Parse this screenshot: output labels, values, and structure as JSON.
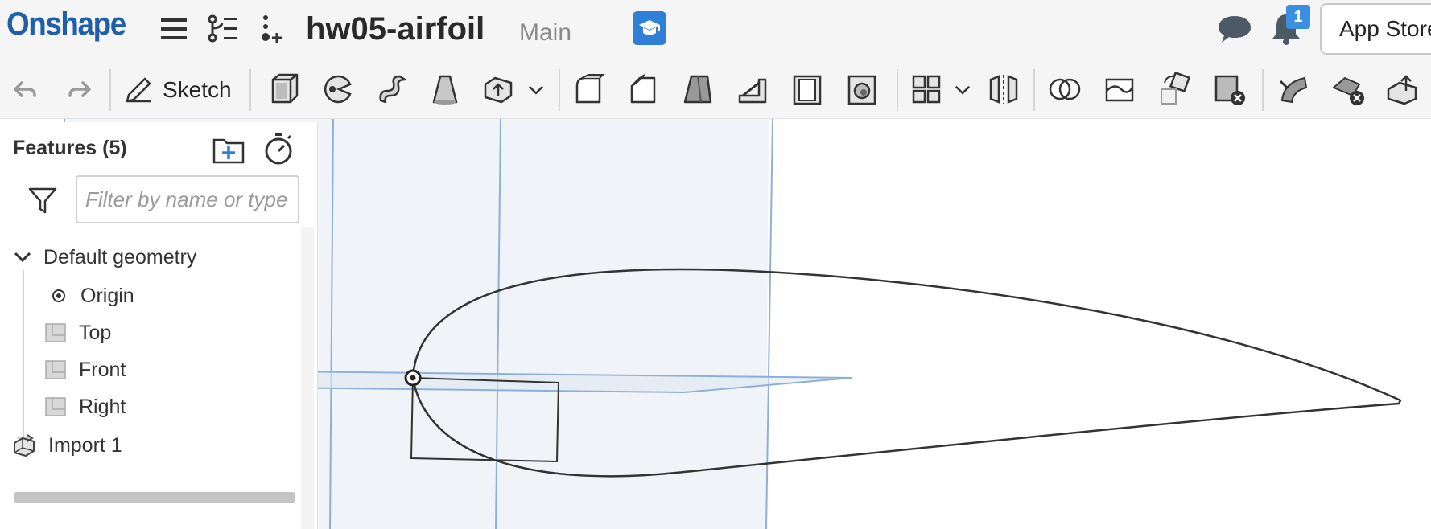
{
  "header": {
    "logo": "Onshape",
    "doc_title": "hw05-airfoil",
    "branch": "Main",
    "notification_count": "1",
    "app_store_label": "App Store",
    "accent_color": "#1f5ea8",
    "badge_color": "#3b8ee0"
  },
  "toolbar": {
    "sketch_label": "Sketch",
    "icons": [
      "undo-icon",
      "redo-icon",
      "sketch-icon",
      "extrude-icon",
      "revolve-icon",
      "sweep-icon",
      "loft-icon",
      "thicken-icon",
      "more-dropdown-icon",
      "fillet-icon",
      "chamfer-icon",
      "draft-icon",
      "rib-icon",
      "shell-icon",
      "hole-icon",
      "pattern-icon",
      "pattern-dropdown-icon",
      "mirror-icon",
      "boolean-icon",
      "split-icon",
      "transform-icon",
      "delete-part-icon",
      "modify-fillet-icon",
      "delete-face-icon",
      "move-face-icon"
    ]
  },
  "feature_panel": {
    "title": "Features (5)",
    "filter_placeholder": "Filter by name or type",
    "default_geometry_label": "Default geometry",
    "items": [
      {
        "label": "Origin",
        "icon": "origin-icon"
      },
      {
        "label": "Top",
        "icon": "plane-icon"
      },
      {
        "label": "Front",
        "icon": "plane-icon"
      },
      {
        "label": "Right",
        "icon": "plane-icon"
      }
    ],
    "import_label": "Import 1"
  }
}
